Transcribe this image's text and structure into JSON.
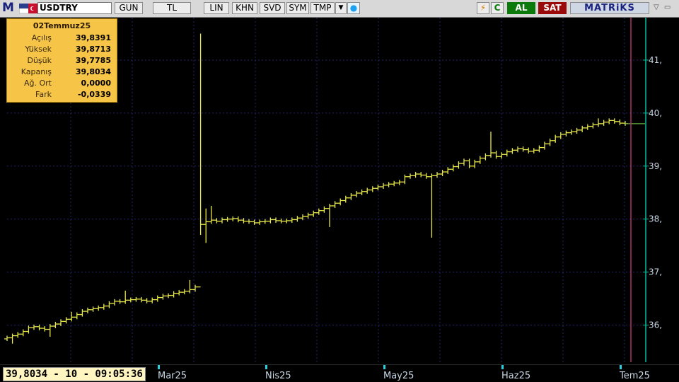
{
  "toolbar": {
    "logo": "M",
    "symbol": "USDTRY",
    "buttons": [
      "GUN",
      "TL",
      "LIN",
      "KHN",
      "SVD",
      "SYM",
      "TMP"
    ],
    "dropdown_icon": "triangle-down-icon",
    "twitter_icon": "bird-icon",
    "flash_icon": "lightning-icon",
    "refresh_label": "C",
    "buy_label": "AL",
    "sell_label": "SAT",
    "brand": "MATRiKS",
    "colors": {
      "buy": "#0a7a0a",
      "sell": "#9a0a0a",
      "brand": "#1a237e"
    }
  },
  "info_box": {
    "date": "02Temmuz25",
    "rows": [
      {
        "label": "Açılış",
        "value": "39,8391"
      },
      {
        "label": "Yüksek",
        "value": "39,8713"
      },
      {
        "label": "Düşük",
        "value": "39,7785"
      },
      {
        "label": "Kapanış",
        "value": "39,8034"
      },
      {
        "label": "Ağ. Ort",
        "value": "0,0000"
      },
      {
        "label": "Fark",
        "value": "-0,0339"
      }
    ]
  },
  "status": {
    "readout": "39,8034 - 10 - 09:05:36"
  },
  "chart_data": {
    "type": "ohlc",
    "colors": {
      "bars": "#e8e84a",
      "grid": "#23236a",
      "axis": "#00c0a0",
      "cursor": "#b0306c"
    },
    "y_axis": {
      "ticks": [
        "36,",
        "37,",
        "38,",
        "39,",
        "40,",
        "41,"
      ],
      "tick_values": [
        36,
        37,
        38,
        39,
        40,
        41
      ],
      "ylim": [
        35.3,
        41.8
      ],
      "side": "right"
    },
    "x_axis": {
      "labels": [
        "Mar25",
        "Nis25",
        "May25",
        "Haz25",
        "Tem25"
      ],
      "label_index": [
        28,
        48,
        70,
        92,
        114
      ]
    },
    "series": [
      {
        "close": [
          35.76,
          35.8,
          35.83,
          35.88,
          35.95,
          35.97,
          35.94,
          35.92,
          35.98,
          36.02,
          36.07,
          36.11,
          36.15,
          36.2,
          36.26,
          36.29,
          36.31,
          36.33,
          36.36,
          36.41,
          36.45,
          36.44,
          36.47,
          36.48,
          36.49,
          36.47,
          36.45,
          36.48,
          36.52,
          36.55,
          36.56,
          36.6,
          36.62,
          36.64,
          36.67,
          36.72,
          37.9,
          37.95,
          37.98,
          37.96,
          37.99,
          38.0,
          38.01,
          37.98,
          37.96,
          37.95,
          37.93,
          37.95,
          37.96,
          37.99,
          37.97,
          37.96,
          37.97,
          37.99,
          38.02,
          38.05,
          38.08,
          38.12,
          38.16,
          38.2,
          38.25,
          38.3,
          38.35,
          38.4,
          38.45,
          38.49,
          38.52,
          38.55,
          38.58,
          38.61,
          38.64,
          38.66,
          38.68,
          38.7,
          38.8,
          38.82,
          38.85,
          38.83,
          38.8,
          38.82,
          38.85,
          38.89,
          38.94,
          38.99,
          39.05,
          39.1,
          39.0,
          39.08,
          39.15,
          39.2,
          39.25,
          39.18,
          39.22,
          39.27,
          39.3,
          39.33,
          39.31,
          39.28,
          39.3,
          39.35,
          39.42,
          39.48,
          39.55,
          39.6,
          39.63,
          39.65,
          39.68,
          39.72,
          39.75,
          39.78,
          39.8,
          39.83,
          39.86,
          39.84,
          39.81,
          39.8
        ],
        "highs": {
          "36": 41.5,
          "37": 38.2,
          "38": 38.25,
          "12": 36.25,
          "22": 36.65,
          "34": 36.85,
          "90": 39.65,
          "110": 39.9
        },
        "lows": {
          "37": 37.55,
          "36": 37.7,
          "1": 35.65,
          "79": 37.65,
          "8": 35.78,
          "60": 37.85
        }
      }
    ]
  }
}
